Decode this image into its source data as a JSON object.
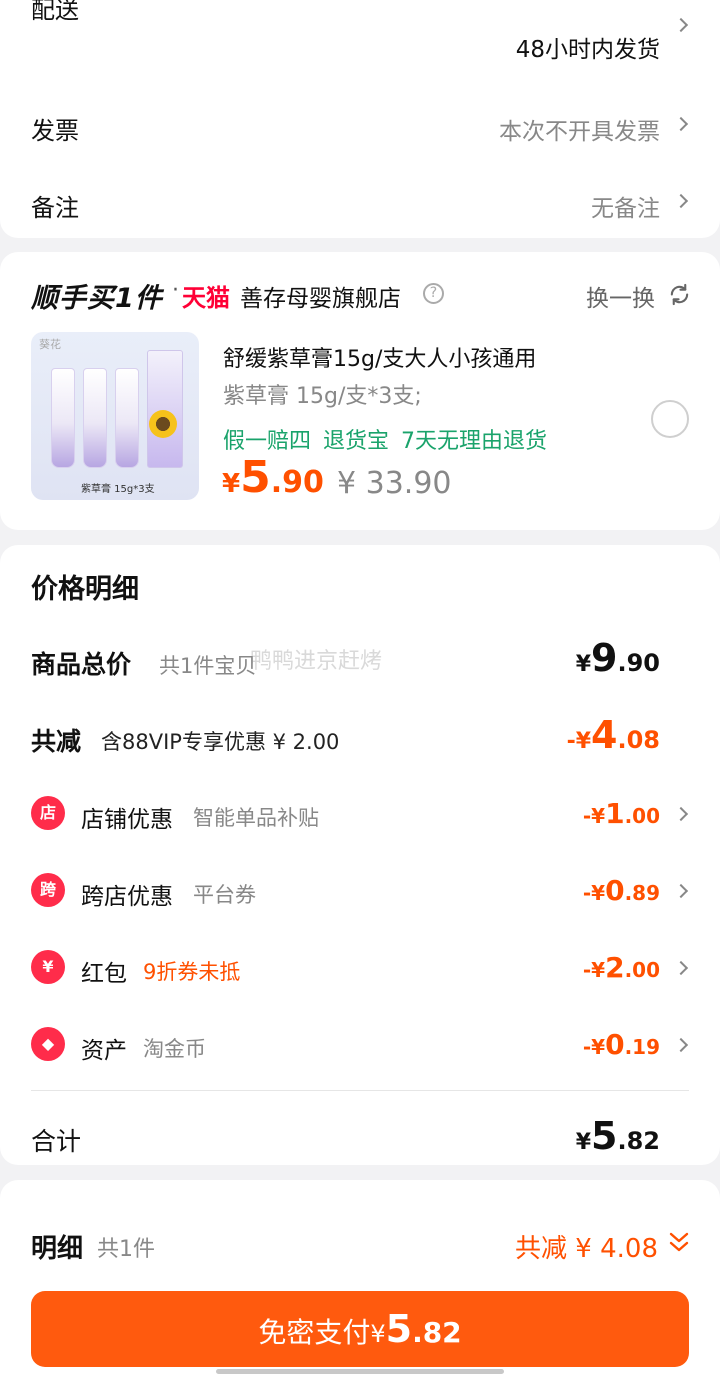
{
  "top": {
    "delivery_label": "配送",
    "delivery_value": "48小时内发货",
    "invoice_label": "发票",
    "invoice_value": "本次不开具发票",
    "note_label": "备注",
    "note_value": "无备注"
  },
  "upsell": {
    "promo_title": "顺手买1件",
    "dot": "·",
    "tmall": "天猫",
    "shop_name": "善存母婴旗舰店",
    "help": "?",
    "swap": "换一换",
    "image_brand": "葵花",
    "image_caption": "紫草膏 15g*3支",
    "product_title": "舒缓紫草膏15g/支大人小孩通用",
    "product_spec": "紫草膏 15g/支*3支;",
    "tags": [
      "假一赔四",
      "退货宝",
      "7天无理由退货"
    ],
    "price_cur": "¥",
    "price_int": "5",
    "price_dec": ".90",
    "price_orig": "¥ 33.90"
  },
  "detail": {
    "title": "价格明细",
    "watermark": "鸭鸭进京赶烤",
    "total_goods_label": "商品总价",
    "total_goods_sub": "共1件宝贝",
    "total_goods_cur": "¥",
    "total_goods_int": "9",
    "total_goods_dec": ".90",
    "discount_label": "共减",
    "discount_sub": "含88VIP专享优惠 ¥ 2.00",
    "discount_cur": "-¥",
    "discount_int": "4",
    "discount_dec": ".08",
    "items": [
      {
        "icon": "店",
        "label": "店铺优惠",
        "sub": "智能单品补贴",
        "cur": "-¥",
        "int": "1",
        "dec": ".00"
      },
      {
        "icon": "跨",
        "label": "跨店优惠",
        "sub": "平台券",
        "cur": "-¥",
        "int": "0",
        "dec": ".89"
      },
      {
        "icon": "¥",
        "label": "红包",
        "sub": "9折券未抵",
        "cur": "-¥",
        "int": "2",
        "dec": ".00"
      },
      {
        "icon": "◆",
        "label": "资产",
        "sub": "淘金币",
        "cur": "-¥",
        "int": "0",
        "dec": ".19"
      }
    ],
    "sum_label": "合计",
    "sum_cur": "¥",
    "sum_int": "5",
    "sum_dec": ".82"
  },
  "bottom": {
    "mx_label": "明细",
    "mx_sub": "共1件",
    "mx_save": "共减 ¥ 4.08",
    "pay_text": "免密支付",
    "pay_cur": "¥",
    "pay_int": "5",
    "pay_dec": ".82"
  },
  "colors": {
    "accent": "#ff5000",
    "tag_green": "#1aa36b",
    "tmall_red": "#ff0036",
    "icon_red": "#ff2c4a"
  }
}
